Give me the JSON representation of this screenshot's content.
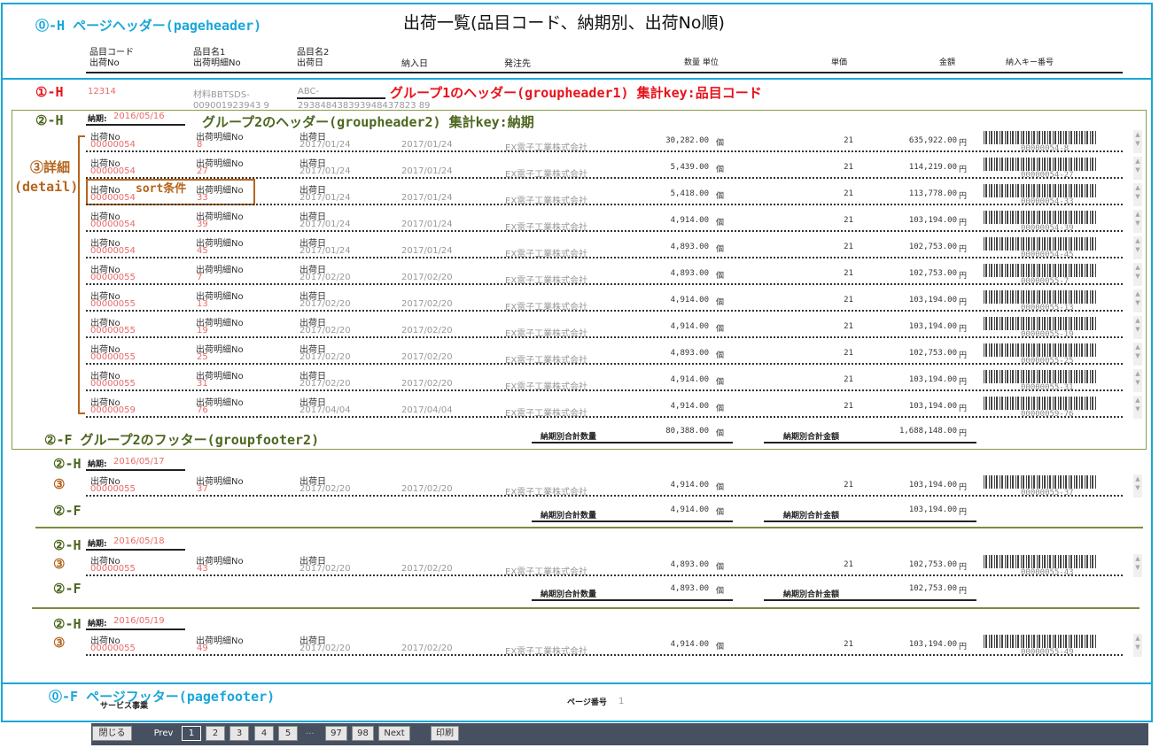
{
  "title": "出荷一覧(品目コード、納期別、出荷No順)",
  "annot": {
    "ph": "⓪-H  ページヘッダー(pageheader)",
    "g1h": "①-H",
    "g1h_desc": "グループ1のヘッダー(groupheader1)  集計key:品目コード",
    "g2h": "②-H",
    "g2h_desc": "グループ2のヘッダー(groupheader2)  集計key:納期",
    "detail1": "③詳細",
    "detail2": "(detail)",
    "sort": "sort条件",
    "g2f_desc": "②-F グループ2のフッター(groupfooter2)",
    "g2h_s": "②-H",
    "d_s": "③",
    "g2f_s": "②-F",
    "pf": "⓪-F ページフッター(pagefooter)"
  },
  "header": {
    "c1a": "品目コード",
    "c1b": "出荷No",
    "c2a": "品目名1",
    "c2b": "出荷明細No",
    "c3a": "品目名2",
    "c3b": "出荷日",
    "c4": "納入日",
    "c5": "発注先",
    "c6": "数量  単位",
    "c7": "単価",
    "c8": "金額",
    "c9": "納入キー番号"
  },
  "group1": {
    "code": "12314",
    "name1": "材料BBTSDS-",
    "name1b": "009001923943 9",
    "name2": "ABC-",
    "name2b": "293848438393948437823 89"
  },
  "labels": {
    "nouki": "納期:",
    "shukkaNo": "出荷No",
    "meisai": "出荷明細No",
    "shukkabi": "出荷日",
    "sum_qty": "納期別合計数量",
    "sum_amt": "納期別合計金額",
    "unit": "個",
    "yen": "円"
  },
  "groups": [
    {
      "date": "2016/05/16",
      "rows": [
        [
          "00000054",
          "8",
          "2017/01/24",
          "2017/01/24",
          "EX電子工業株式会社",
          "30,282.00",
          "21",
          "635,922.00",
          "00000054-8"
        ],
        [
          "00000054",
          "27",
          "2017/01/24",
          "2017/01/24",
          "EX電子工業株式会社",
          "5,439.00",
          "21",
          "114,219.00",
          "00000054-27"
        ],
        [
          "00000054",
          "33",
          "2017/01/24",
          "2017/01/24",
          "EX電子工業株式会社",
          "5,418.00",
          "21",
          "113,778.00",
          "00000054-33"
        ],
        [
          "00000054",
          "39",
          "2017/01/24",
          "2017/01/24",
          "EX電子工業株式会社",
          "4,914.00",
          "21",
          "103,194.00",
          "00000054-39"
        ],
        [
          "00000054",
          "45",
          "2017/01/24",
          "2017/01/24",
          "EX電子工業株式会社",
          "4,893.00",
          "21",
          "102,753.00",
          "00000054-45"
        ],
        [
          "00000055",
          "7",
          "2017/02/20",
          "2017/02/20",
          "EX電子工業株式会社",
          "4,893.00",
          "21",
          "102,753.00",
          "00000055-7"
        ],
        [
          "00000055",
          "13",
          "2017/02/20",
          "2017/02/20",
          "EX電子工業株式会社",
          "4,914.00",
          "21",
          "103,194.00",
          "00000055-13"
        ],
        [
          "00000055",
          "19",
          "2017/02/20",
          "2017/02/20",
          "EX電子工業株式会社",
          "4,914.00",
          "21",
          "103,194.00",
          "00000055-19"
        ],
        [
          "00000055",
          "25",
          "2017/02/20",
          "2017/02/20",
          "EX電子工業株式会社",
          "4,893.00",
          "21",
          "102,753.00",
          "00000055-25"
        ],
        [
          "00000055",
          "31",
          "2017/02/20",
          "2017/02/20",
          "EX電子工業株式会社",
          "4,914.00",
          "21",
          "103,194.00",
          "00000055-31"
        ],
        [
          "00000059",
          "76",
          "2017/04/04",
          "2017/04/04",
          "EX電子工業株式会社",
          "4,914.00",
          "21",
          "103,194.00",
          "00000059-76"
        ]
      ],
      "sum_qty": "80,388.00",
      "sum_amt": "1,688,148.00"
    },
    {
      "date": "2016/05/17",
      "rows": [
        [
          "00000055",
          "37",
          "2017/02/20",
          "2017/02/20",
          "EX電子工業株式会社",
          "4,914.00",
          "21",
          "103,194.00",
          "00000055-37"
        ]
      ],
      "sum_qty": "4,914.00",
      "sum_amt": "103,194.00"
    },
    {
      "date": "2016/05/18",
      "rows": [
        [
          "00000055",
          "43",
          "2017/02/20",
          "2017/02/20",
          "EX電子工業株式会社",
          "4,893.00",
          "21",
          "102,753.00",
          "00000055-43"
        ]
      ],
      "sum_qty": "4,893.00",
      "sum_amt": "102,753.00"
    },
    {
      "date": "2016/05/19",
      "rows": [
        [
          "00000055",
          "49",
          "2017/02/20",
          "2017/02/20",
          "EX電子工業株式会社",
          "4,914.00",
          "21",
          "103,194.00",
          "00000055-49"
        ]
      ]
    }
  ],
  "footer": {
    "service": "サービス事業",
    "page_label": "ページ番号",
    "page_no": "1"
  },
  "toolbar": {
    "close": "閉じる",
    "prev": "Prev",
    "pages": [
      "1",
      "2",
      "3",
      "4",
      "5"
    ],
    "ellipsis": "...",
    "pages_end": [
      "97",
      "98"
    ],
    "next": "Next",
    "print": "印刷"
  }
}
